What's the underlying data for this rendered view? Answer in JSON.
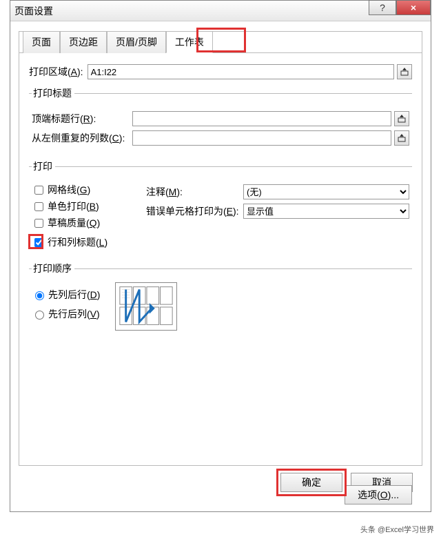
{
  "window": {
    "title": "页面设置"
  },
  "titlebar_buttons": {
    "help_glyph": "?",
    "close_glyph": "×"
  },
  "tabs": {
    "page": "页面",
    "margins": "页边距",
    "headerfooter": "页眉/页脚",
    "sheet": "工作表"
  },
  "fields": {
    "print_area_label_pre": "打印区域(",
    "print_area_key": "A",
    "print_area_label_post": "):",
    "print_area_value": "A1:I22",
    "print_titles_legend": "打印标题",
    "top_row_label_pre": "顶端标题行(",
    "top_row_key": "R",
    "top_row_label_post": "):",
    "top_row_value": "",
    "left_col_label_pre": "从左侧重复的列数(",
    "left_col_key": "C",
    "left_col_label_post": "):",
    "left_col_value": ""
  },
  "print": {
    "legend": "打印",
    "gridlines_pre": "网格线(",
    "gridlines_key": "G",
    "gridlines_post": ")",
    "bw_pre": "单色打印(",
    "bw_key": "B",
    "bw_post": ")",
    "draft_pre": "草稿质量(",
    "draft_key": "Q",
    "draft_post": ")",
    "rowcol_pre": "行和列标题(",
    "rowcol_key": "L",
    "rowcol_post": ")",
    "comments_label_pre": "注释(",
    "comments_key": "M",
    "comments_post": "):",
    "comments_value": "(无)",
    "errors_label_pre": "错误单元格打印为(",
    "errors_key": "E",
    "errors_post": "):",
    "errors_value": "显示值"
  },
  "order": {
    "legend": "打印顺序",
    "down_over_pre": "先列后行(",
    "down_over_key": "D",
    "down_over_post": ")",
    "over_down_pre": "先行后列(",
    "over_down_key": "V",
    "over_down_post": ")"
  },
  "buttons": {
    "options_pre": "选项(",
    "options_key": "O",
    "options_post": ")...",
    "ok": "确定",
    "cancel": "取消"
  },
  "watermark": "头条 @Excel学习世界"
}
